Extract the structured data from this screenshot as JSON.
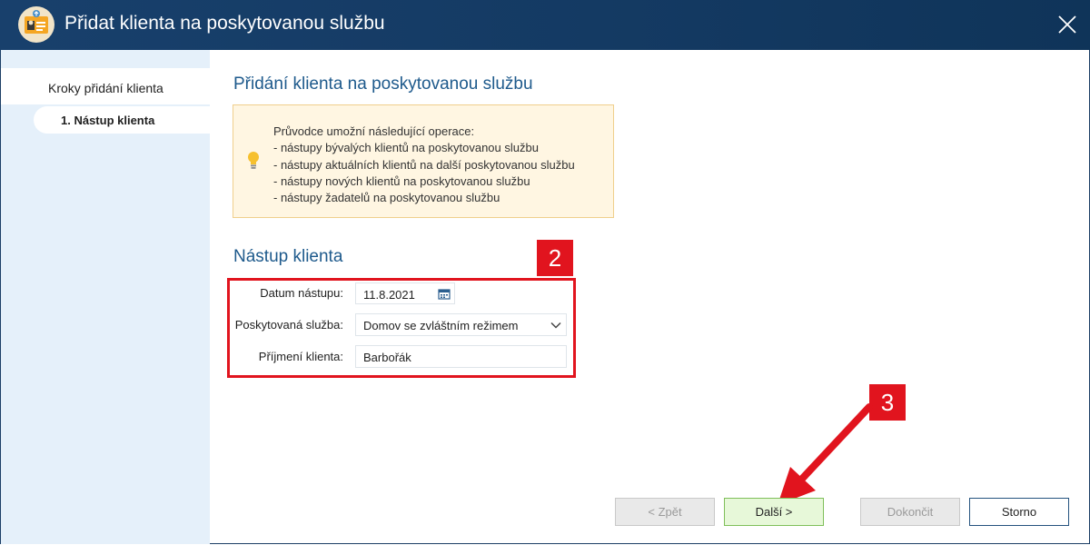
{
  "window": {
    "title": "Přidat klienta na poskytovanou službu",
    "app_icon": "client-card-icon",
    "close_icon": "close-icon"
  },
  "sidebar": {
    "heading": "Kroky přidání klienta",
    "steps": [
      {
        "label": "1. Nástup klienta",
        "active": true
      }
    ]
  },
  "main": {
    "heading": "Přidání klienta na poskytovanou službu",
    "info": {
      "icon": "lightbulb-icon",
      "lines": [
        "Průvodce umožní následující operace:",
        "- nástupy bývalých klientů na poskytovanou službu",
        "- nástupy aktuálních klientů na další poskytovanou službu",
        "- nástupy nových klientů na poskytovanou službu",
        "- nástupy žadatelů na poskytovanou službu"
      ]
    },
    "section_heading": "Nástup klienta",
    "form": {
      "date_label": "Datum nástupu:",
      "date_value": "11.8.2021",
      "service_label": "Poskytovaná služba:",
      "service_value": "Domov se zvláštním režimem",
      "surname_label": "Příjmení klienta:",
      "surname_value": "Barbořák"
    }
  },
  "annotations": {
    "form_badge": "2",
    "next_badge": "3",
    "color": "#e1141e"
  },
  "buttons": {
    "back": "< Zpět",
    "next": "Další >",
    "finish": "Dokončit",
    "cancel": "Storno"
  }
}
